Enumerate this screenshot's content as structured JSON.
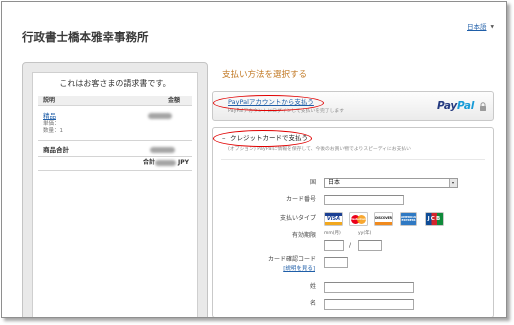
{
  "header": {
    "title": "行政書士橋本雅幸事務所",
    "language": "日本語",
    "language_caret": "▼"
  },
  "invoice": {
    "heading": "これはお客さまの請求書です。",
    "col_description": "説明",
    "col_amount": "金額",
    "item_name": "精品",
    "unit_price_label": "単価：",
    "quantity": "数量：1",
    "subtotal_label": "商品合計",
    "total_label": "合計",
    "currency": "JPY"
  },
  "payment": {
    "heading": "支払い方法を選択する",
    "paypal_option": {
      "link": "PayPalアカウントから支払う",
      "note": "PayPalアカウントにログインして支払いを完了します",
      "logo_pay": "Pay",
      "logo_pal": "Pal"
    },
    "card_option": {
      "toggle": "–",
      "link": "クレジットカードで支払う",
      "note": "(オプション) PayPalに情報を保存して、今後のお買い物でよりスピーディにお支払い"
    },
    "form": {
      "country_label": "国",
      "country_value": "日本",
      "card_number_label": "カード番号",
      "card_type_label": "支払いタイプ",
      "card_logos": [
        {
          "icon": "visa-logo",
          "text": "VISA"
        },
        {
          "icon": "mastercard-logo",
          "text": "MasterCard"
        },
        {
          "icon": "discover-logo",
          "text": "DISCOVER"
        },
        {
          "icon": "amex-logo",
          "text": "AMERICAN EXPRESS"
        },
        {
          "icon": "jcb-logo",
          "text": "JCB"
        }
      ],
      "expiry_label": "有効期限",
      "month_hint": "mm(月)",
      "year_hint": "yy(年)",
      "expiry_separator": "/",
      "cvv_label": "カード確認コード",
      "cvv_help_link": "[説明を見る]",
      "last_name_label": "姓",
      "first_name_label": "名"
    }
  },
  "colors": {
    "heading_orange": "#c27a26",
    "link_blue": "#1f5ea8",
    "annotation_red": "#e00000",
    "paypal_dark": "#253b80",
    "paypal_light": "#179bd7"
  }
}
